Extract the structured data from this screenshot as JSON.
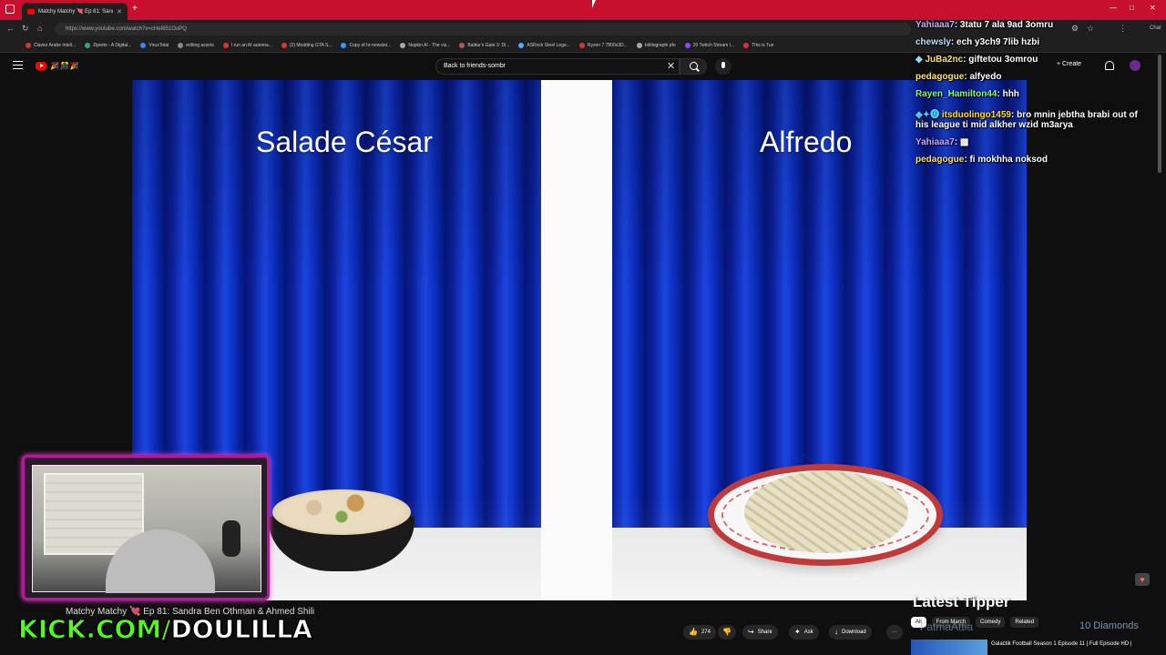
{
  "browser": {
    "tab_title": "Matchy Matchy 💘 Ep 81: Sandra",
    "url": "https://www.youtube.com/watch?v=cHeI851OuPQ",
    "new_tab_label": "+",
    "bookmarks": [
      "Clavier Arabe Intell...",
      "Ziperto - A Digital...",
      "VirusTotal",
      "editing assets",
      "I run an AI automa...",
      "(2) Modding GTA S...",
      "Copy of hr-newslet...",
      "Napkin AI - The vis...",
      "Baldur's Gate 3: Di...",
      "ASRock Steel Lege...",
      "Ryzen 7 7800x3D...",
      "bibliographi pfe",
      "20 Twitch Stream I...",
      "This is Tun"
    ],
    "window_controls": [
      "—",
      "□",
      "✕"
    ],
    "chat_label": "Chat"
  },
  "youtube": {
    "search_value": "Back to friends-sombr",
    "create_label": "Create",
    "doodle_text": "🎉🎊🎉"
  },
  "video": {
    "left_food": "Salade César",
    "right_food": "Alfredo",
    "title": "Matchy Matchy 💘 Ep 81: Sandra Ben Othman & Ahmed Shili",
    "like_count": "274",
    "share_label": "Share",
    "ask_label": "Ask",
    "download_label": "Download",
    "more_label": "···"
  },
  "overlay": {
    "kick_prefix": "KICK.COM/",
    "kick_name": "DOULILLA",
    "latest_tipper": "Latest Tipper",
    "tipper_name": "FatmaAttia",
    "diamonds": "10 Diamonds"
  },
  "chat": [
    {
      "user": "Yahiaaa7",
      "color": "#c9a6ff",
      "text": ": 3tatu 7 ala 9ad 3omru"
    },
    {
      "user": "chewsly",
      "color": "#b7e3ff",
      "text": ": ech y3ch9 7lib hzbi"
    },
    {
      "user": "JuBa2nc",
      "color": "#ffe066",
      "text": ": giftetou 3omrou"
    },
    {
      "user": "pedagogue",
      "color": "#ffe066",
      "text": ": alfyedo"
    },
    {
      "user": "Rayen_Hamilton44",
      "color": "#7dff7a",
      "text": ": hhh"
    },
    {
      "user": "itsduolingo1459",
      "color": "#ffd84a",
      "text": ": bro mnin jebtha brabi out of"
    },
    {
      "user": "",
      "color": "#ffffff",
      "text": "his league ti mid alkher wzid m3arya"
    },
    {
      "user": "Yahiaaa7",
      "color": "#c9a6ff",
      "text": ":"
    },
    {
      "user": "pedagogue",
      "color": "#ffe066",
      "text": ": fi mokhha noksod"
    }
  ],
  "related": {
    "chips": [
      "All",
      "From March",
      "Comedy",
      "Related"
    ],
    "video_title": "Galactik Football Season 1 Episode 11 | Full Episode HD |"
  }
}
